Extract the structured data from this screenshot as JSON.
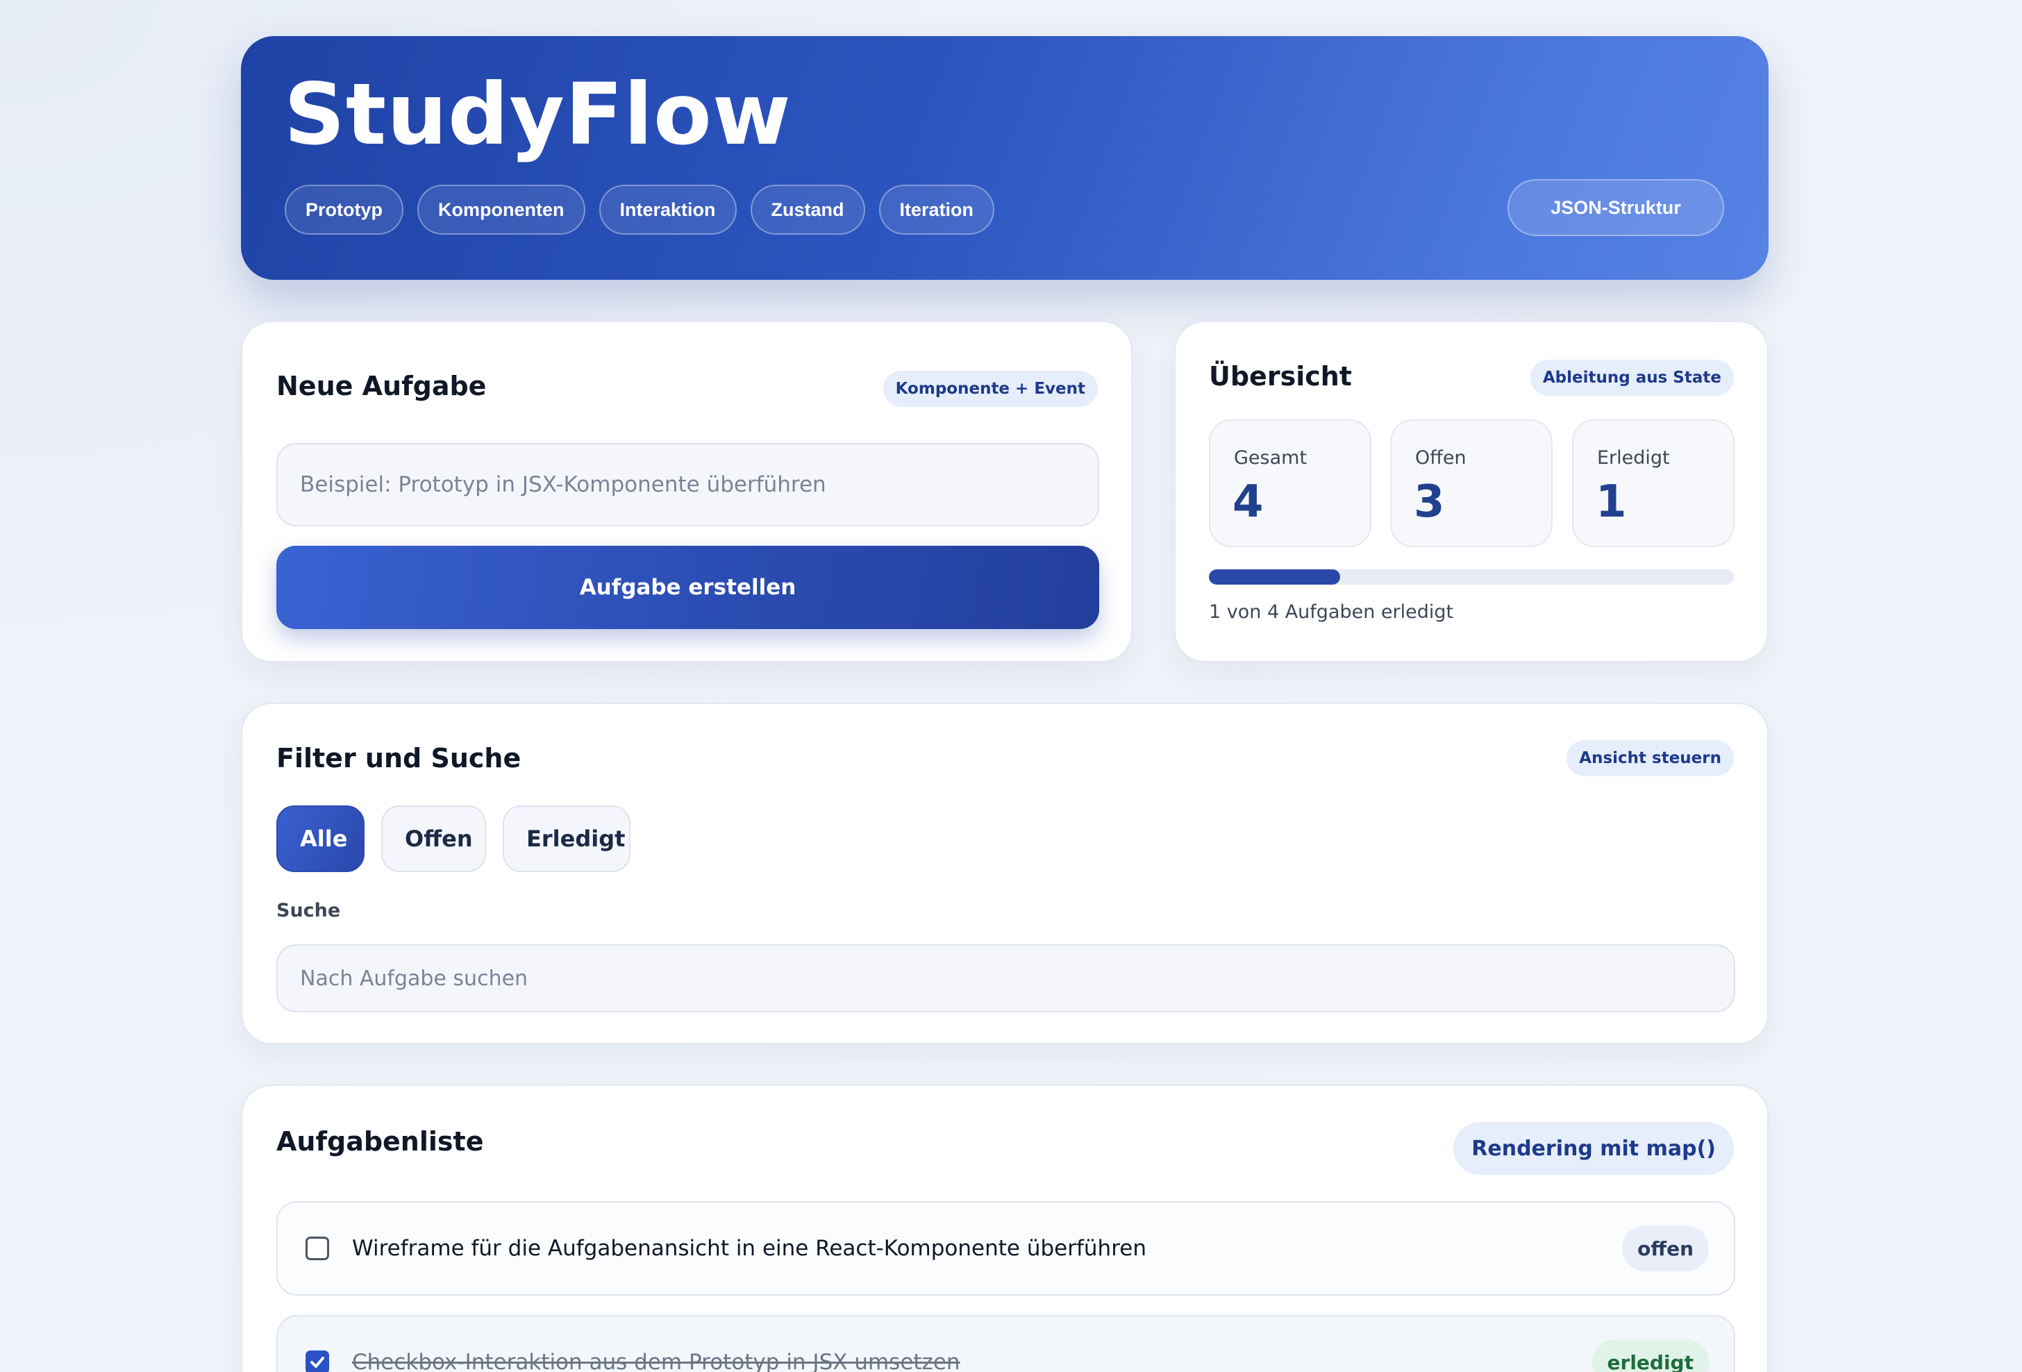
{
  "app": {
    "title": "StudyFlow",
    "nav_tabs": [
      "Prototyp",
      "Komponenten",
      "Interaktion",
      "Zustand",
      "Iteration"
    ],
    "json_button": "JSON-Struktur"
  },
  "new_task": {
    "title": "Neue Aufgabe",
    "tag": "Komponente + Event",
    "input_placeholder": "Beispiel: Prototyp in JSX-Komponente überführen",
    "input_value": "",
    "submit_label": "Aufgabe erstellen"
  },
  "overview": {
    "title": "Übersicht",
    "tag": "Ableitung aus State",
    "stats": [
      {
        "label": "Gesamt",
        "value": "4"
      },
      {
        "label": "Offen",
        "value": "3"
      },
      {
        "label": "Erledigt",
        "value": "1"
      }
    ],
    "progress_fraction": 0.25,
    "progress_text": "1 von 4 Aufgaben erledigt"
  },
  "filter": {
    "title": "Filter und Suche",
    "tag": "Ansicht steuern",
    "buttons": [
      "Alle",
      "Offen",
      "Erledigt"
    ],
    "active": "Alle",
    "search_label": "Suche",
    "search_placeholder": "Nach Aufgabe suchen",
    "search_value": ""
  },
  "task_list": {
    "title": "Aufgabenliste",
    "tag": "Rendering mit map()",
    "items": [
      {
        "text": "Wireframe für die Aufgabenansicht in eine React-Komponente überführen",
        "status": "offen",
        "done": false
      },
      {
        "text": "Checkbox-Interaktion aus dem Prototyp in JSX umsetzen",
        "status": "erledigt",
        "done": true
      }
    ]
  },
  "colors": {
    "accent": "#2a48a8",
    "hero_start": "#1f43a6",
    "hero_end": "#5782e4",
    "done_badge": "#e1f3e8"
  }
}
